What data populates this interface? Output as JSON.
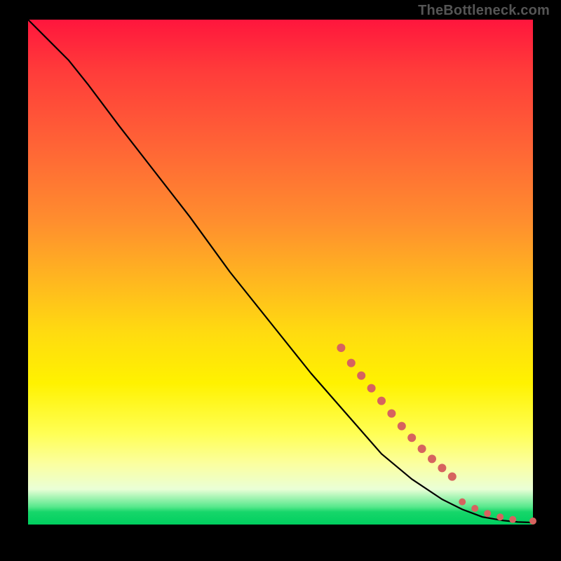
{
  "watermark": "TheBottleneck.com",
  "chart_data": {
    "type": "line",
    "title": "",
    "xlabel": "",
    "ylabel": "",
    "xlim": [
      0,
      100
    ],
    "ylim": [
      0,
      100
    ],
    "background_gradient": {
      "top": "#ff163d",
      "mid": "#fff200",
      "bottom": "#00cf5f"
    },
    "series": [
      {
        "name": "curve",
        "type": "line",
        "color": "#000000",
        "x": [
          0,
          4,
          8,
          12,
          18,
          25,
          32,
          40,
          48,
          56,
          63,
          70,
          76,
          82,
          86,
          90,
          94,
          97,
          100
        ],
        "y": [
          100,
          96,
          92,
          87,
          79,
          70,
          61,
          50,
          40,
          30,
          22,
          14,
          9,
          5,
          3,
          1.5,
          0.8,
          0.5,
          0.4
        ]
      },
      {
        "name": "points-thick-segment",
        "type": "scatter",
        "color": "#d6635f",
        "marker_size": 12,
        "x": [
          62,
          64,
          66,
          68,
          70,
          72,
          74,
          76,
          78,
          80,
          82,
          84
        ],
        "y": [
          35,
          32,
          29.5,
          27,
          24.5,
          22,
          19.5,
          17.2,
          15,
          13,
          11.2,
          9.5
        ]
      },
      {
        "name": "points-near-floor",
        "type": "scatter",
        "color": "#d6635f",
        "marker_size": 10,
        "x": [
          86,
          88.5,
          91,
          93.5,
          96,
          100
        ],
        "y": [
          4.5,
          3.2,
          2.2,
          1.5,
          1.0,
          0.7
        ]
      }
    ]
  }
}
